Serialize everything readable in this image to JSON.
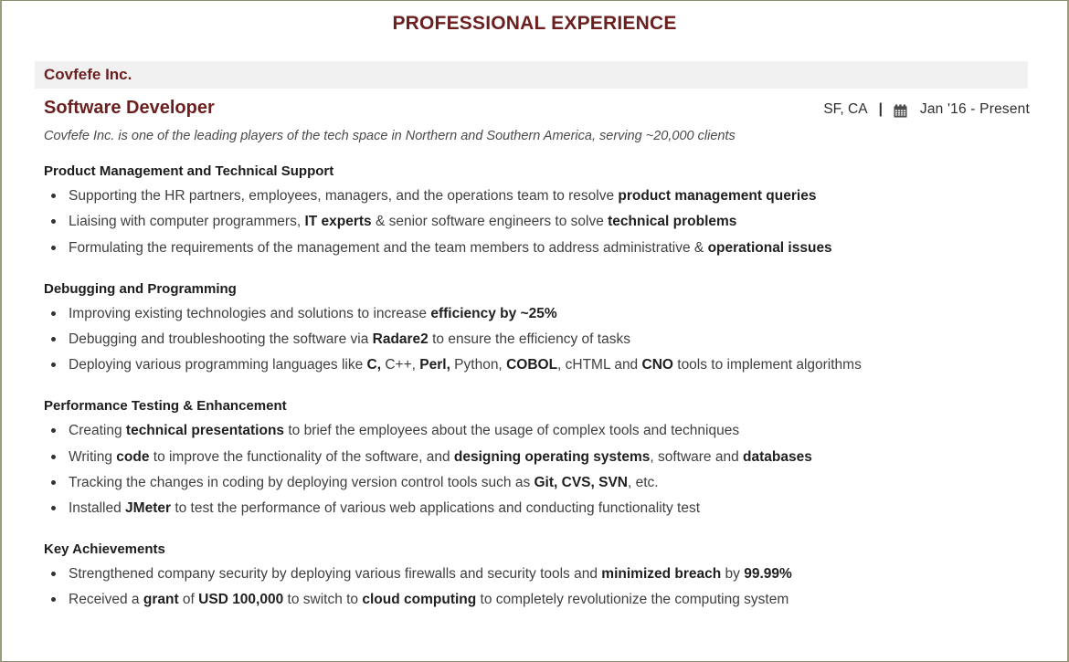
{
  "document": {
    "title": "PROFESSIONAL EXPERIENCE",
    "title_color": "#6b1f1f",
    "accent_bar_color": "#f1f1f1",
    "border_color": "#8a8a6e"
  },
  "experience": {
    "company": "Covfefe Inc.",
    "role": "Software Developer",
    "location": "SF, CA",
    "separator": "|",
    "calendar_icon": "calendar-icon",
    "dates": "Jan '16 -  Present",
    "tagline": "Covfefe Inc. is one of the leading players of the tech space in Northern and Southern America, serving ~20,000 clients",
    "sections": [
      {
        "heading": "Product Management and Technical Support",
        "bullets": [
          [
            {
              "t": "Supporting the HR partners, employees, managers, and the operations team to resolve ",
              "b": false
            },
            {
              "t": "product management queries",
              "b": true
            }
          ],
          [
            {
              "t": "Liaising with computer programmers, ",
              "b": false
            },
            {
              "t": "IT experts",
              "b": true
            },
            {
              "t": " & senior software engineers to solve ",
              "b": false
            },
            {
              "t": "technical problems",
              "b": true
            }
          ],
          [
            {
              "t": "Formulating the requirements of the management and the team members to address administrative & ",
              "b": false
            },
            {
              "t": "operational issues",
              "b": true
            }
          ]
        ]
      },
      {
        "heading": "Debugging and Programming",
        "bullets": [
          [
            {
              "t": "Improving existing technologies and solutions to increase ",
              "b": false
            },
            {
              "t": "efficiency by ",
              "b": true
            },
            {
              "t": "~25%",
              "b": true
            }
          ],
          [
            {
              "t": "Debugging and troubleshooting the software via ",
              "b": false
            },
            {
              "t": "Radare2",
              "b": true
            },
            {
              "t": " to ensure the efficiency of tasks",
              "b": false
            }
          ],
          [
            {
              "t": "Deploying various programming languages like ",
              "b": false
            },
            {
              "t": "C,",
              "b": true
            },
            {
              "t": " C++, ",
              "b": false
            },
            {
              "t": "Perl,",
              "b": true
            },
            {
              "t": " Python, ",
              "b": false
            },
            {
              "t": "COBOL",
              "b": true
            },
            {
              "t": ", cHTML and ",
              "b": false
            },
            {
              "t": "CNO",
              "b": true
            },
            {
              "t": " tools to implement algorithms",
              "b": false
            }
          ]
        ]
      },
      {
        "heading": "Performance Testing & Enhancement",
        "bullets": [
          [
            {
              "t": "Creating ",
              "b": false
            },
            {
              "t": "technical presentations",
              "b": true
            },
            {
              "t": " to brief the employees about the usage of complex tools and techniques",
              "b": false
            }
          ],
          [
            {
              "t": "Writing ",
              "b": false
            },
            {
              "t": "code",
              "b": true
            },
            {
              "t": " to improve the functionality of the software, and ",
              "b": false
            },
            {
              "t": "designing operating systems",
              "b": true
            },
            {
              "t": ", software and ",
              "b": false
            },
            {
              "t": "databases",
              "b": true
            }
          ],
          [
            {
              "t": "Tracking the changes in coding by deploying version control tools such as ",
              "b": false
            },
            {
              "t": "Git, CVS, SVN",
              "b": true
            },
            {
              "t": ", etc.",
              "b": false
            }
          ],
          [
            {
              "t": "Installed ",
              "b": false
            },
            {
              "t": "JMeter",
              "b": true
            },
            {
              "t": " to test the performance of various web applications and conducting functionality test",
              "b": false
            }
          ]
        ]
      },
      {
        "heading": "Key Achievements",
        "bullets": [
          [
            {
              "t": "Strengthened company security by deploying various firewalls and security tools and ",
              "b": false
            },
            {
              "t": "minimized breach",
              "b": true
            },
            {
              "t": " by ",
              "b": false
            },
            {
              "t": "99.99%",
              "b": true
            }
          ],
          [
            {
              "t": "Received a ",
              "b": false
            },
            {
              "t": "grant",
              "b": true
            },
            {
              "t": " of ",
              "b": false
            },
            {
              "t": "USD 100,000",
              "b": true
            },
            {
              "t": " to switch to ",
              "b": false
            },
            {
              "t": "cloud computing",
              "b": true
            },
            {
              "t": " to completely revolutionize the computing system",
              "b": false
            }
          ]
        ]
      }
    ]
  }
}
